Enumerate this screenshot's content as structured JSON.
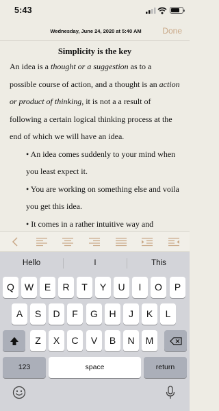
{
  "status": {
    "time": "5:43"
  },
  "nav": {
    "date": "Wednesday, June 24, 2020 at 5:40 AM",
    "done": "Done"
  },
  "document": {
    "title": "Simplicity is the key",
    "para": [
      {
        "t": "An idea is a ",
        "i": false
      },
      {
        "t": "thought or a suggestion",
        "i": true
      },
      {
        "t": " as to a possible course of action, and a thought is an ",
        "i": false
      },
      {
        "t": "action or product of thinking",
        "i": true
      },
      {
        "t": ", it is not a a result of following a certain logical thinking process at the end of which we will have an idea.",
        "i": false
      }
    ],
    "bullets": [
      "• An idea comes suddenly to your mind when you least expect it.",
      "• You are working on something else and voila you get this idea.",
      "• It comes in a rather intuitive way and"
    ]
  },
  "format_bar": {
    "icons": [
      "chevron-left-icon",
      "align-left-icon",
      "align-center-icon",
      "align-right-icon",
      "align-justify-icon",
      "indent-icon",
      "outdent-icon"
    ],
    "accent": "#c9a887"
  },
  "keyboard": {
    "predictions": [
      "Hello",
      "I",
      "This"
    ],
    "row1": [
      "Q",
      "W",
      "E",
      "R",
      "T",
      "Y",
      "U",
      "I",
      "O",
      "P"
    ],
    "row2": [
      "A",
      "S",
      "D",
      "F",
      "G",
      "H",
      "J",
      "K",
      "L"
    ],
    "row3": [
      "Z",
      "X",
      "C",
      "V",
      "B",
      "N",
      "M"
    ],
    "numbers": "123",
    "space": "space",
    "return": "return"
  }
}
